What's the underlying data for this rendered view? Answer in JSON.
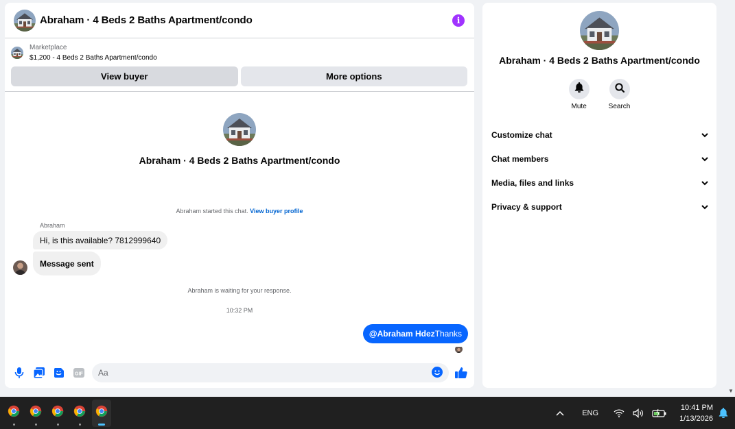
{
  "chat": {
    "title": "Abraham · 4 Beds 2 Baths Apartment/condo",
    "marketplace_label": "Marketplace",
    "listing": "$1,200 - 4 Beds 2 Baths Apartment/condo",
    "view_buyer": "View buyer",
    "more_options": "More options",
    "intro_title": "Abraham · 4 Beds 2 Baths Apartment/condo",
    "started_text": "Abraham started this chat.",
    "view_profile": "View buyer profile",
    "sender_name": "Abraham",
    "message_1": "Hi, is this available? 7812999640",
    "message_2": "Message sent",
    "waiting_text": "Abraham is waiting for your response.",
    "timestamp": "10:32 PM",
    "outgoing_mention": "@Abraham Hdez",
    "outgoing_text": "Thanks",
    "composer_placeholder": "Aa"
  },
  "info": {
    "title": "Abraham · 4 Beds 2 Baths Apartment/condo",
    "mute_label": "Mute",
    "search_label": "Search",
    "sections": [
      {
        "label": "Customize chat"
      },
      {
        "label": "Chat members"
      },
      {
        "label": "Media, files and links"
      },
      {
        "label": "Privacy & support"
      }
    ]
  },
  "taskbar": {
    "apps": [
      "chrome-icon",
      "chrome-icon",
      "chrome-icon",
      "chrome-icon",
      "chrome-icon"
    ],
    "language": "ENG",
    "time": "10:41 PM",
    "date": "1/13/2026"
  },
  "colors": {
    "accent": "#0866ff",
    "info_purple": "#a033ff",
    "taskbar": "#202020"
  }
}
